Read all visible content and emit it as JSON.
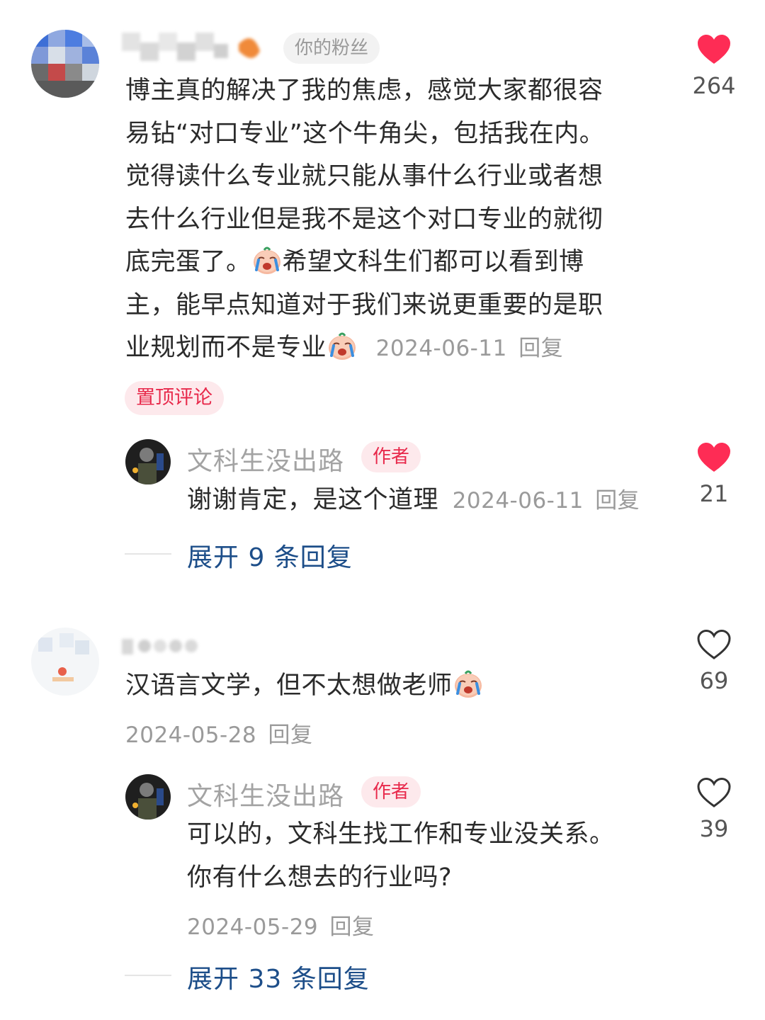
{
  "comments": [
    {
      "username": "n˙˙˙˙",
      "badge": "你的粉丝",
      "text_lines": [
        "博主真的解决了我的焦虑，感觉大家都很容",
        "易钻“对口专业”这个牛角尖，包括我在内。",
        "觉得读什么专业就只能从事什么行业或者想",
        "去什么行业但是我不是这个对口专业的就彻",
        "底完蛋了。",
        "希望文科生们都可以看到博",
        "主，能早点知道对于我们来说更重要的是职",
        "业规划而不是专业"
      ],
      "date": "2024-06-11",
      "reply_label": "回复",
      "likes": "264",
      "liked": true,
      "pinned_label": "置顶评论",
      "reply": {
        "author": "文科生没出路",
        "author_tag": "作者",
        "text": "谢谢肯定，是这个道理",
        "date": "2024-06-11",
        "reply_label": "回复",
        "likes": "21",
        "liked": true
      },
      "expand_label": "展开 9 条回复"
    },
    {
      "username": "n˙˙˙˙",
      "text": "汉语言文学，但不太想做老师",
      "date": "2024-05-28",
      "reply_label": "回复",
      "likes": "69",
      "liked": false,
      "reply": {
        "author": "文科生没出路",
        "author_tag": "作者",
        "text_lines": [
          "可以的，文科生找工作和专业没关系。",
          "你有什么想去的行业吗?"
        ],
        "date": "2024-05-29",
        "reply_label": "回复",
        "likes": "39",
        "liked": false
      },
      "expand_label": "展开 33 条回复"
    }
  ],
  "colors": {
    "like_red": "#fe2c55",
    "expand_blue": "#1d4e89",
    "tag_red": "#e8294b"
  },
  "icons": {
    "liked": "heart-filled-icon",
    "unliked": "heart-outline-icon",
    "emoji": "crying-face-icon"
  }
}
